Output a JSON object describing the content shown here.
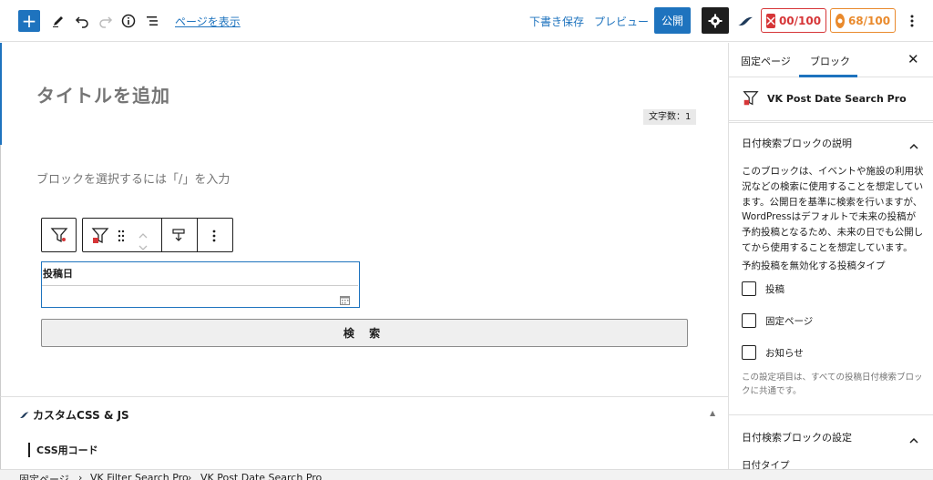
{
  "topbar": {
    "view_page": "ページを表示",
    "save_draft": "下書き保存",
    "preview": "プレビュー",
    "publish": "公開",
    "score_red": "00/100",
    "score_orange": "68/100"
  },
  "editor": {
    "title_placeholder": "タイトルを追加",
    "char_count": "文字数：1",
    "block_placeholder": "ブロックを選択するには「/」を入力",
    "date_label": "投稿日",
    "search_button": "検 索"
  },
  "meta": {
    "custom_css_title": "カスタムCSS & JS",
    "css_code_label": "CSS用コード"
  },
  "breadcrumb": {
    "items": [
      "固定ページ",
      "VK Filter Search Pro",
      "VK Post Date Search Pro"
    ]
  },
  "sidebar": {
    "tabs": [
      "固定ページ",
      "ブロック"
    ],
    "block_name": "VK Post Date Search Pro",
    "panel1_title": "日付検索ブロックの説明",
    "description": "このブロックは、イベントや施設の利用状況などの検索に使用することを想定しています。公開日を基準に検索を行いますが、WordPressはデフォルトで未来の投稿が予約投稿となるため、未来の日でも公開してから使用することを想定しています。",
    "disable_label": "予約投稿を無効化する投稿タイプ",
    "post_types": [
      "投稿",
      "固定ページ",
      "お知らせ"
    ],
    "help_text": "この設定項目は、すべての投稿日付検索ブロックに共通です。",
    "panel2_title": "日付検索ブロックの設定",
    "date_type_label": "日付タイプ"
  },
  "colors": {
    "accent": "#1e73be",
    "score_red": "#d63638",
    "score_orange": "#e98a2d"
  }
}
